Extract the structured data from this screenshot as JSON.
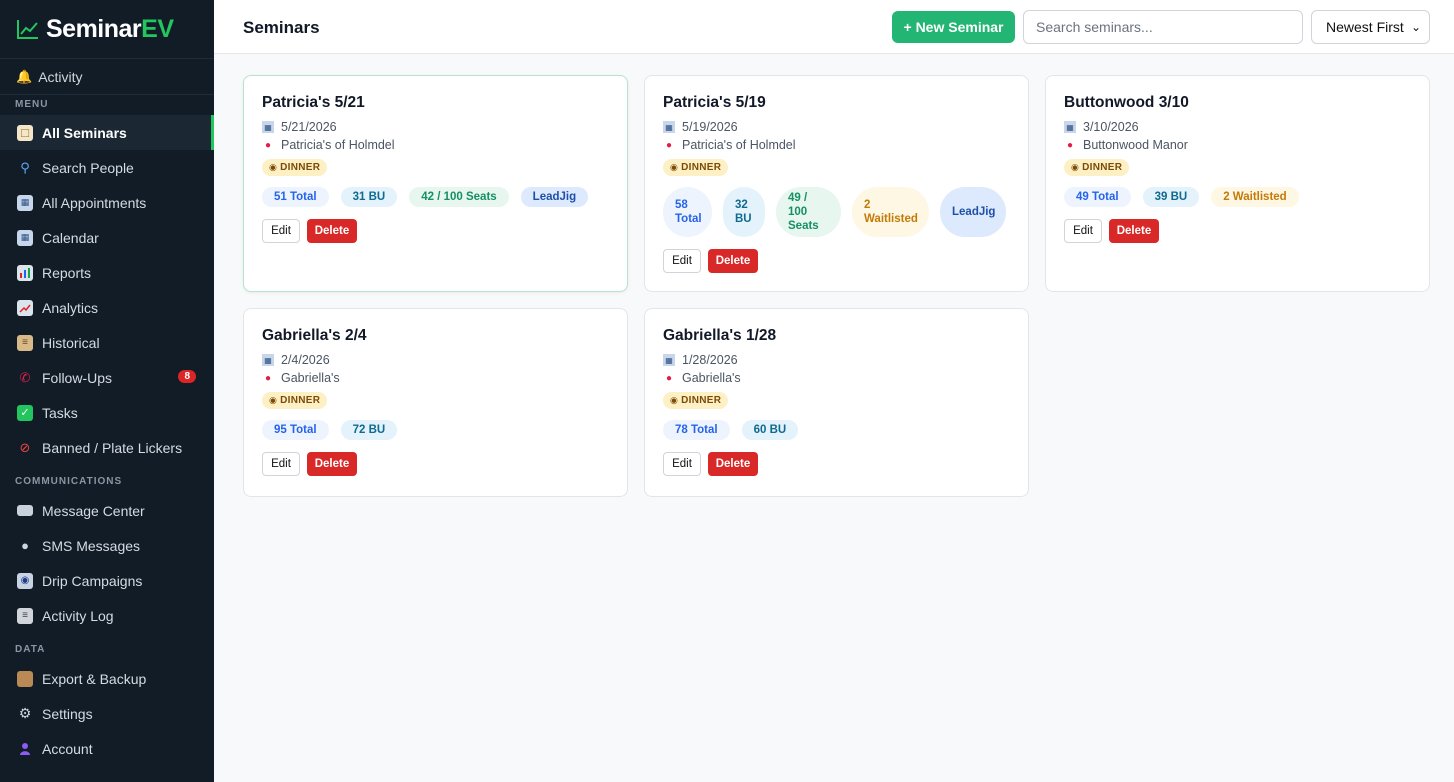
{
  "brand": {
    "name_a": "Seminar",
    "name_b": "EV"
  },
  "sidebar": {
    "activity": "Activity",
    "sections": {
      "menu": "MENU",
      "communications": "COMMUNICATIONS",
      "data": "DATA"
    },
    "menu_items": [
      {
        "label": "All Seminars",
        "icon": "clipboard-icon"
      },
      {
        "label": "Search People",
        "icon": "search-icon"
      },
      {
        "label": "All Appointments",
        "icon": "calendar-icon"
      },
      {
        "label": "Calendar",
        "icon": "calendar-icon"
      },
      {
        "label": "Reports",
        "icon": "bar-chart-icon"
      },
      {
        "label": "Analytics",
        "icon": "trend-chart-icon"
      },
      {
        "label": "Historical",
        "icon": "scroll-icon"
      },
      {
        "label": "Follow-Ups",
        "icon": "phone-icon",
        "badge": "8"
      },
      {
        "label": "Tasks",
        "icon": "checkbox-icon"
      },
      {
        "label": "Banned / Plate Lickers",
        "icon": "prohibited-icon"
      }
    ],
    "comm_items": [
      {
        "label": "Message Center",
        "icon": "envelope-icon"
      },
      {
        "label": "SMS Messages",
        "icon": "chat-bubble-icon"
      },
      {
        "label": "Drip Campaigns",
        "icon": "target-icon"
      },
      {
        "label": "Activity Log",
        "icon": "log-icon"
      }
    ],
    "data_items": [
      {
        "label": "Export & Backup",
        "icon": "box-icon"
      },
      {
        "label": "Settings",
        "icon": "gear-icon"
      },
      {
        "label": "Account",
        "icon": "user-icon"
      }
    ]
  },
  "header": {
    "title": "Seminars",
    "new_button": "+ New Seminar",
    "search_placeholder": "Search seminars...",
    "sort_selected": "Newest First"
  },
  "cards": [
    {
      "title": "Patricia's 5/21",
      "date": "5/21/2026",
      "venue": "Patricia's of Holmdel",
      "tag": "DINNER",
      "total": "51 Total",
      "bu": "31 BU",
      "seats": "42 / 100 Seats",
      "waitlisted": "",
      "leadjig": "LeadJig"
    },
    {
      "title": "Patricia's 5/19",
      "date": "5/19/2026",
      "venue": "Patricia's of Holmdel",
      "tag": "DINNER",
      "total": "58 Total",
      "bu": "32 BU",
      "seats": "49 / 100 Seats",
      "waitlisted": "2 Waitlisted",
      "leadjig": "LeadJig"
    },
    {
      "title": "Buttonwood 3/10",
      "date": "3/10/2026",
      "venue": "Buttonwood Manor",
      "tag": "DINNER",
      "total": "49 Total",
      "bu": "39 BU",
      "seats": "",
      "waitlisted": "2 Waitlisted",
      "leadjig": ""
    },
    {
      "title": "Gabriella's 2/4",
      "date": "2/4/2026",
      "venue": "Gabriella's",
      "tag": "DINNER",
      "total": "95 Total",
      "bu": "72 BU",
      "seats": "",
      "waitlisted": "",
      "leadjig": ""
    },
    {
      "title": "Gabriella's 1/28",
      "date": "1/28/2026",
      "venue": "Gabriella's",
      "tag": "DINNER",
      "total": "78 Total",
      "bu": "60 BU",
      "seats": "",
      "waitlisted": "",
      "leadjig": ""
    }
  ],
  "card_actions": {
    "edit": "Edit",
    "delete": "Delete"
  },
  "colors": {
    "accent": "#22b573",
    "danger": "#d92828",
    "sidebar_bg": "#111c27"
  }
}
